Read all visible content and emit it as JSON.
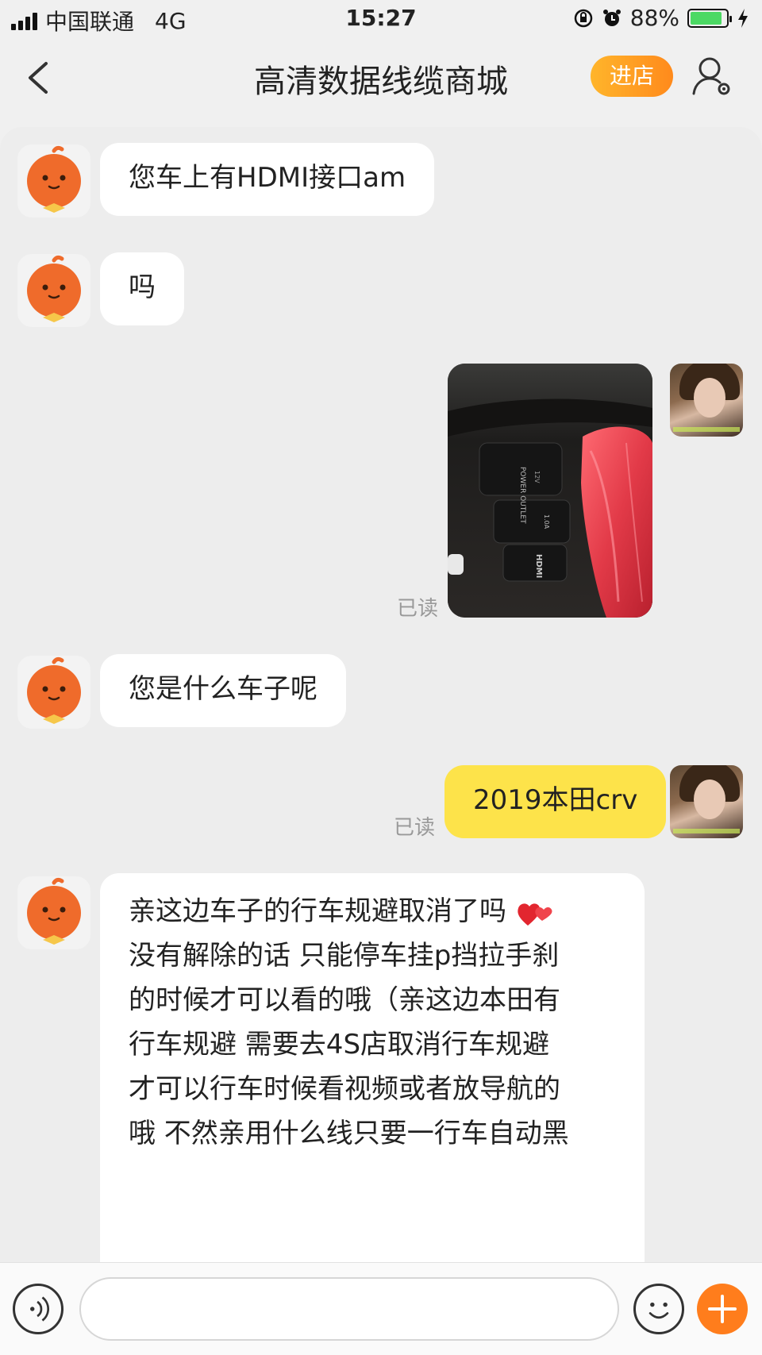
{
  "status_bar": {
    "carrier": "中国联通",
    "network": "4G",
    "time": "15:27",
    "battery": "88%",
    "battery_level": 0.88
  },
  "header": {
    "title": "高清数据线缆商城",
    "enter_shop": "进店"
  },
  "messages": [
    {
      "from": "shop",
      "text": "您车上有HDMI接口am"
    },
    {
      "from": "shop",
      "text": "吗"
    },
    {
      "from": "me",
      "type": "image",
      "read": "已读",
      "port_labels": [
        "POWER OUTLET",
        "12V",
        "1.0A",
        "HDMI"
      ]
    },
    {
      "from": "shop",
      "text": "您是什么车子呢"
    },
    {
      "from": "me",
      "text": "2019本田crv",
      "read": "已读"
    },
    {
      "from": "shop",
      "lines": [
        "亲这边车子的行车规避取消了吗",
        "没有解除的话 只能停车挂p挡拉手刹",
        "的时候才可以看的哦（亲这边本田有",
        "行车规避 需要去4S店取消行车规避",
        "才可以行车时候看视频或者放导航的",
        "哦  不然亲用什么线只要一行车自动黑"
      ]
    }
  ],
  "input": {
    "placeholder": ""
  },
  "colors": {
    "accent": "#ff8a1c",
    "my_bubble": "#fde34a",
    "bot_avatar": "#ef6b2b"
  },
  "icons": {
    "back": "chevron-left-icon",
    "user": "user-settings-icon",
    "voice": "voice-icon",
    "emoji": "smiley-icon",
    "plus": "plus-icon",
    "heart": "heart-icon"
  }
}
